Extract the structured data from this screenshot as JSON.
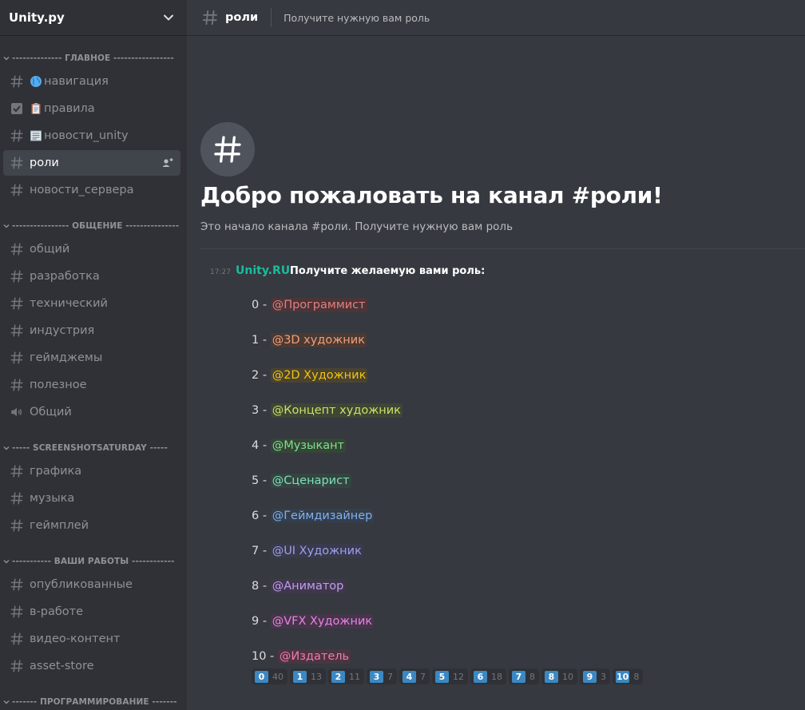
{
  "server": {
    "name": "Unity.py"
  },
  "sidebar": {
    "categories": [
      {
        "label": "-------------- ГЛАВНОЕ -----------------"
      },
      {
        "label": "---------------- ОБЩЕНИЕ ---------------"
      },
      {
        "label": "----- SCREENSHOTSATURDAY -----"
      },
      {
        "label": "----------- ВАШИ РАБОТЫ ------------"
      },
      {
        "label": "------- ПРОГРАММИРОВАНИЕ -------"
      }
    ],
    "channels": [
      {
        "label": "навигация",
        "icon": "hash-icon",
        "emoji": "globe-icon"
      },
      {
        "label": "правила",
        "icon": "checkbox-icon",
        "emoji": "clipboard-icon"
      },
      {
        "label": "новости_unity",
        "icon": "hash-icon",
        "emoji": "newspaper-icon"
      },
      {
        "label": "роли",
        "icon": "hash-icon",
        "active": true
      },
      {
        "label": "новости_сервера",
        "icon": "hash-icon"
      },
      {
        "label": "общий",
        "icon": "hash-icon"
      },
      {
        "label": "разработка",
        "icon": "hash-icon"
      },
      {
        "label": "технический",
        "icon": "hash-icon"
      },
      {
        "label": "индустрия",
        "icon": "hash-icon"
      },
      {
        "label": "геймджемы",
        "icon": "hash-icon"
      },
      {
        "label": "полезное",
        "icon": "hash-icon"
      },
      {
        "label": "Общий",
        "icon": "speaker-icon"
      },
      {
        "label": "графика",
        "icon": "hash-icon"
      },
      {
        "label": "музыка",
        "icon": "hash-icon"
      },
      {
        "label": "геймплей",
        "icon": "hash-icon"
      },
      {
        "label": "опубликованные",
        "icon": "hash-icon"
      },
      {
        "label": "в-работе",
        "icon": "hash-icon"
      },
      {
        "label": "видео-контент",
        "icon": "hash-icon"
      },
      {
        "label": "asset-store",
        "icon": "hash-icon"
      }
    ]
  },
  "header": {
    "channel": "роли",
    "topic": "Получите нужную вам роль"
  },
  "welcome": {
    "title": "Добро пожаловать на канал #роли!",
    "subtitle": "Это начало канала #роли. Получите нужную вам роль"
  },
  "message": {
    "time": "17:27",
    "author": "Unity.RU",
    "text": "Получите желаемую вами роль:"
  },
  "roles": [
    {
      "prefix": "0 - ",
      "mention": "@Программист",
      "color": "#e67e7e",
      "bg": "#4a3538"
    },
    {
      "prefix": "1 - ",
      "mention": "@3D художник",
      "color": "#f0a07a",
      "bg": "#4b3a34"
    },
    {
      "prefix": "2 - ",
      "mention": "@2D Художник",
      "color": "#f1c40f",
      "bg": "#4a4330"
    },
    {
      "prefix": "3 - ",
      "mention": "@Концепт художник",
      "color": "#c6e36b",
      "bg": "#3f4634"
    },
    {
      "prefix": "4 - ",
      "mention": "@Музыкант",
      "color": "#7ee08a",
      "bg": "#354537"
    },
    {
      "prefix": "5 - ",
      "mention": "@Сценарист",
      "color": "#7ee0c0",
      "bg": "#34453f"
    },
    {
      "prefix": "6 - ",
      "mention": "@Геймдизайнер",
      "color": "#7fb0f0",
      "bg": "#343e4b"
    },
    {
      "prefix": "7 - ",
      "mention": "@UI Художник",
      "color": "#9f9ff0",
      "bg": "#393a4b"
    },
    {
      "prefix": "8 - ",
      "mention": "@Аниматор",
      "color": "#c39cf0",
      "bg": "#3f384b"
    },
    {
      "prefix": "9 - ",
      "mention": "@VFX Художник",
      "color": "#ea80e6",
      "bg": "#46364a"
    },
    {
      "prefix": "10 - ",
      "mention": "@Издатель",
      "color": "#f07ab0",
      "bg": "#4a3540"
    }
  ],
  "reactions": [
    {
      "emoji": "0",
      "count": "40"
    },
    {
      "emoji": "1",
      "count": "13"
    },
    {
      "emoji": "2",
      "count": "11"
    },
    {
      "emoji": "3",
      "count": "7"
    },
    {
      "emoji": "4",
      "count": "7"
    },
    {
      "emoji": "5",
      "count": "12"
    },
    {
      "emoji": "6",
      "count": "18"
    },
    {
      "emoji": "7",
      "count": "8"
    },
    {
      "emoji": "8",
      "count": "10"
    },
    {
      "emoji": "9",
      "count": "3"
    },
    {
      "emoji": "10",
      "count": "8"
    }
  ]
}
